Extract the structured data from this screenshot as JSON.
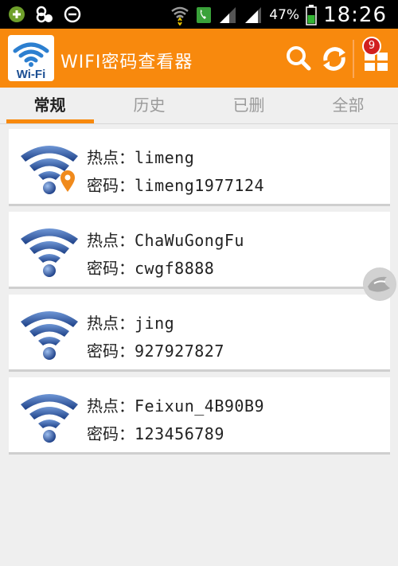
{
  "status_bar": {
    "battery": "47%",
    "time": "18:26"
  },
  "app_bar": {
    "logo_text": "Wi-Fi",
    "title": "WIFI密码查看器",
    "badge_count": "9",
    "icons": [
      "search-icon",
      "refresh-icon",
      "apps-icon"
    ]
  },
  "tabs": [
    {
      "label": "常规",
      "active": true
    },
    {
      "label": "历史",
      "active": false
    },
    {
      "label": "已删",
      "active": false
    },
    {
      "label": "全部",
      "active": false
    }
  ],
  "networks": [
    {
      "hotspot_label": "热点：",
      "hotspot": "limeng",
      "password_label": "密码：",
      "password": "limeng1977124",
      "location_marker": true
    },
    {
      "hotspot_label": "热点：",
      "hotspot": "ChaWuGongFu",
      "password_label": "密码：",
      "password": "cwgf8888",
      "location_marker": false
    },
    {
      "hotspot_label": "热点：",
      "hotspot": "jing",
      "password_label": "密码：",
      "password": "927927827",
      "location_marker": false
    },
    {
      "hotspot_label": "热点：",
      "hotspot": "Feixun_4B90B9",
      "password_label": "密码：",
      "password": "123456789",
      "location_marker": false
    }
  ],
  "colors": {
    "accent": "#f8890d",
    "wifi_blue": "#2a4f9c"
  }
}
